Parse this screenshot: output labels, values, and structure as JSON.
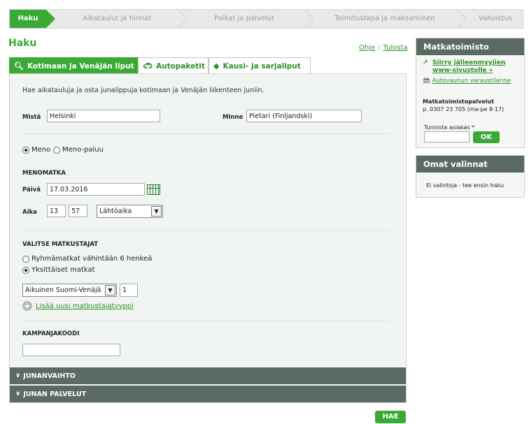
{
  "steps": [
    "Haku",
    "Aikataulut ja hinnat",
    "Paikat ja palvelut",
    "Toimitustapa ja maksaminen",
    "Vahvistus"
  ],
  "page_title": "Haku",
  "links": {
    "help": "Ohje",
    "print": "Tulosta"
  },
  "tabs": [
    {
      "label": "Kotimaan ja Venäjän liput",
      "icon": "search-icon"
    },
    {
      "label": "Autopaketit",
      "icon": "car-icon"
    },
    {
      "label": "Kausi- ja sarjaliput",
      "icon": "ticket-icon"
    }
  ],
  "intro": "Hae aikatauluja ja osta junalippuja kotimaan ja Venäjän liikenteen juniin.",
  "from": {
    "label": "Mistä",
    "value": "Helsinki"
  },
  "to": {
    "label": "Minne",
    "value": "Pietari (Finljandski)"
  },
  "trip_type": {
    "oneway": "Meno",
    "return": "Meno-paluu"
  },
  "outbound": {
    "section": "MENOMATKA",
    "date_label": "Päivä",
    "date": "17.03.2016",
    "time_label": "Aika",
    "hour": "13",
    "minute": "57",
    "time_mode": "Lähtöaika"
  },
  "travellers": {
    "section": "VALITSE MATKUSTAJAT",
    "group": "Ryhmämatkat vähintään 6 henkeä",
    "individual": "Yksittäiset matkat",
    "type": "Aikuinen Suomi-Venäjä",
    "count": "1",
    "add": "Lisää uusi matkustajatyyppi"
  },
  "campaign": {
    "section": "KAMPANJAKOODI",
    "value": ""
  },
  "collapsibles": [
    "JUNANVAIHTO",
    "JUNAN PALVELUT"
  ],
  "search_button": "HAE",
  "agency_box": {
    "title": "Matkatoimisto",
    "link1": "Siirry jälleenmyyjien www-sivustolle",
    "link1_suffix": "»",
    "link2": "Autovaunun varaustilanne",
    "service_title": "Matkatoimistopalvelut",
    "service_phone": "p. 0307 23 705 (ma-pe 8-17)",
    "customer_label": "Tunnista asiakas *",
    "ok": "OK"
  },
  "selections_box": {
    "title": "Omat valinnat",
    "text": "Ei valintoja - tee ensin haku"
  },
  "colors": {
    "brand_green": "#3aa935",
    "dark_bar": "#5b6b63"
  }
}
